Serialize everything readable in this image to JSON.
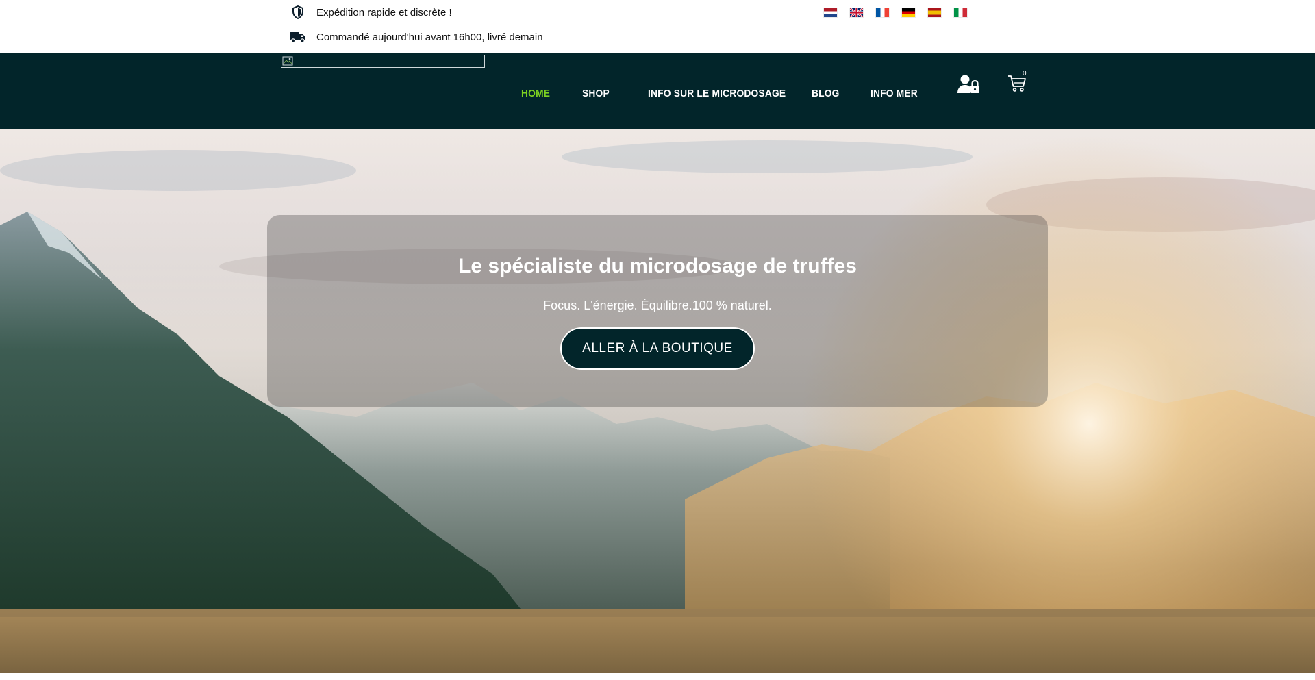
{
  "topbar": {
    "items": [
      {
        "icon": "shield-icon",
        "text": "Expédition rapide et discrète !"
      },
      {
        "icon": "delivery-truck-icon",
        "text": "Commandé aujourd'hui avant 16h00, livré demain"
      }
    ],
    "languages": [
      {
        "code": "nl",
        "icon": "flag-netherlands-icon"
      },
      {
        "code": "en",
        "icon": "flag-uk-icon"
      },
      {
        "code": "fr",
        "icon": "flag-france-icon"
      },
      {
        "code": "de",
        "icon": "flag-germany-icon"
      },
      {
        "code": "es",
        "icon": "flag-spain-icon"
      },
      {
        "code": "it",
        "icon": "flag-italy-icon"
      }
    ]
  },
  "header": {
    "logo_icon": "broken-image-icon",
    "nav": [
      {
        "label": "HOME",
        "active": true
      },
      {
        "label": "SHOP",
        "active": false
      },
      {
        "label": "INFO SUR LE MICRODOSAGE",
        "active": false
      },
      {
        "label": "BLOG",
        "active": false
      },
      {
        "label": "INFO MER",
        "active": false
      }
    ],
    "cart_count": "0",
    "user_icon": "user-lock-icon",
    "cart_icon": "shopping-cart-icon",
    "colors": {
      "background": "#02252a",
      "active": "#7ed321",
      "text": "#ffffff"
    }
  },
  "hero": {
    "title": "Le spécialiste du microdosage de truffes",
    "subtitle": "Focus. L'énergie. Équilibre.100 % naturel.",
    "button": "ALLER À LA BOUTIQUE"
  }
}
